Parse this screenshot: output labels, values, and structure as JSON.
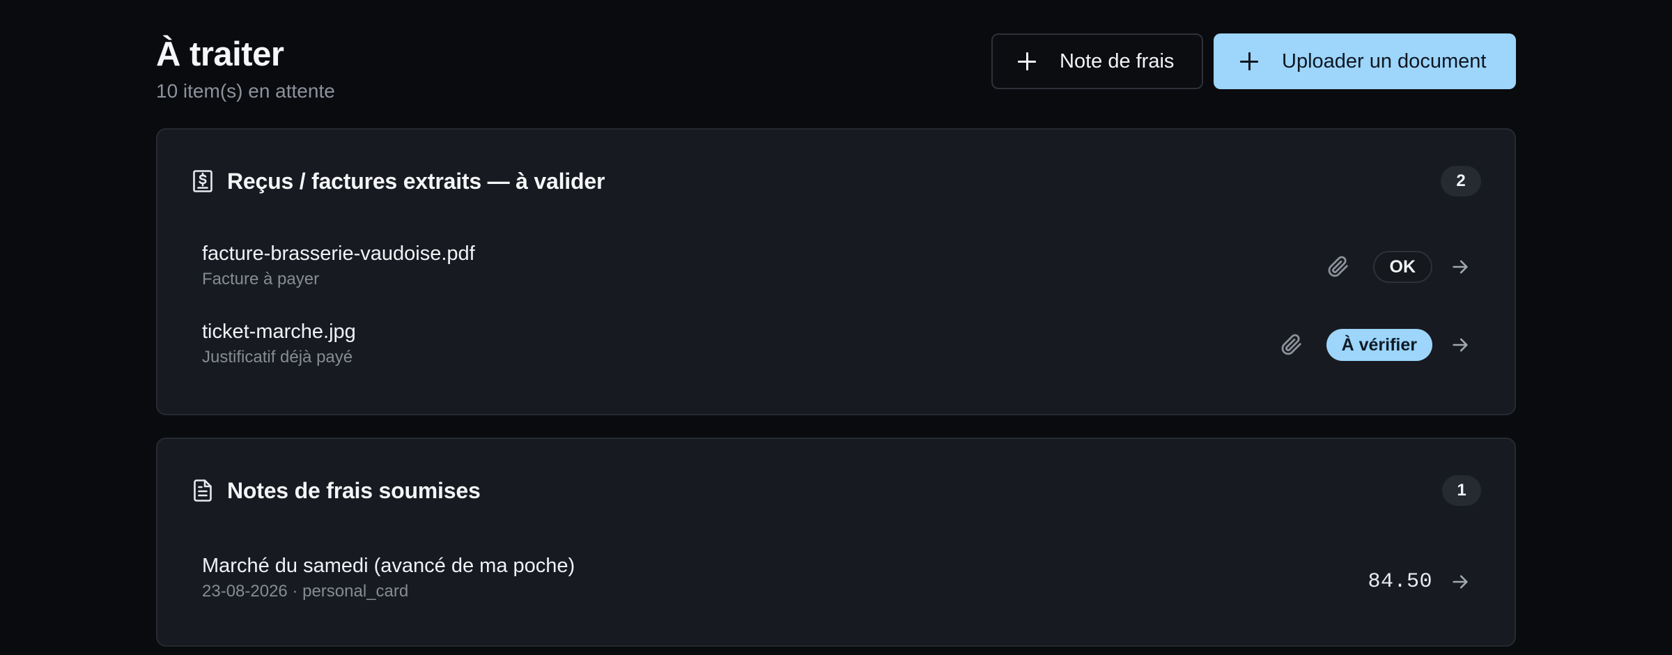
{
  "header": {
    "title": "À traiter",
    "subtitle": "10 item(s) en attente",
    "note_button_label": "Note de frais",
    "upload_button_label": "Uploader un document"
  },
  "receipts_section": {
    "title": "Reçus / factures extraits — à valider",
    "count": "2",
    "icon": "receipt-icon",
    "items": [
      {
        "name": "facture-brasserie-vaudoise.pdf",
        "subtitle": "Facture à payer",
        "status": "OK",
        "status_variant": "outline"
      },
      {
        "name": "ticket-marche.jpg",
        "subtitle": "Justificatif déjà payé",
        "status": "À vérifier",
        "status_variant": "accent"
      }
    ]
  },
  "expense_section": {
    "title": "Notes de frais soumises",
    "count": "1",
    "icon": "document-icon",
    "items": [
      {
        "name": "Marché du samedi (avancé de ma poche)",
        "subtitle": "23-08-2026 · personal_card",
        "amount": "84.50"
      }
    ]
  },
  "colors": {
    "background": "#0a0b0e",
    "card": "#171a20",
    "accent": "#9dd5fb",
    "muted_text": "#868b95"
  }
}
